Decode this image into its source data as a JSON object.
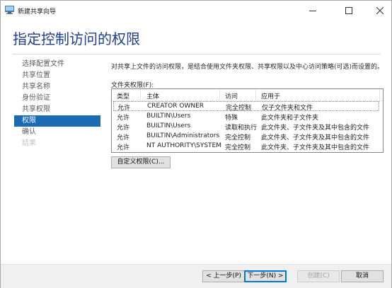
{
  "window": {
    "title": "新建共享向导",
    "heading": "指定控制访问的权限"
  },
  "nav": {
    "items": [
      {
        "label": "选择配置文件",
        "state": "normal"
      },
      {
        "label": "共享位置",
        "state": "normal"
      },
      {
        "label": "共享名称",
        "state": "normal"
      },
      {
        "label": "身份验证",
        "state": "normal"
      },
      {
        "label": "共享权限",
        "state": "normal"
      },
      {
        "label": "权限",
        "state": "active"
      },
      {
        "label": "确认",
        "state": "normal"
      },
      {
        "label": "结果",
        "state": "disabled"
      }
    ]
  },
  "main": {
    "description": "对共享上文件的访问权限，是结合使用文件夹权限、共享权限以及中心访问策略(可选)而设置的。",
    "folder_permissions_label": "文件夹权限(F):",
    "columns": [
      "类型",
      "主体",
      "访问",
      "应用于"
    ],
    "rows": [
      {
        "type": "允许",
        "principal": "CREATOR OWNER",
        "access": "完全控制",
        "applies": "仅子文件夹和文件"
      },
      {
        "type": "允许",
        "principal": "BUILTIN\\Users",
        "access": "特殊",
        "applies": "此文件夹和子文件夹"
      },
      {
        "type": "允许",
        "principal": "BUILTIN\\Users",
        "access": "读取和执行",
        "applies": "此文件夹、子文件夹及其中包含的文件"
      },
      {
        "type": "允许",
        "principal": "BUILTIN\\Administrators",
        "access": "完全控制",
        "applies": "此文件夹、子文件夹及其中包含的文件"
      },
      {
        "type": "允许",
        "principal": "NT AUTHORITY\\SYSTEM",
        "access": "完全控制",
        "applies": "此文件夹、子文件夹及其中包含的文件"
      }
    ],
    "custom_button": "自定义权限(C)..."
  },
  "footer": {
    "prev": "< 上一步(P)",
    "next": "下一步(N) >",
    "create": "创建(C)",
    "cancel": "取消"
  },
  "colors": {
    "accent": "#1a6bb4",
    "heading": "#1e3f8a"
  }
}
